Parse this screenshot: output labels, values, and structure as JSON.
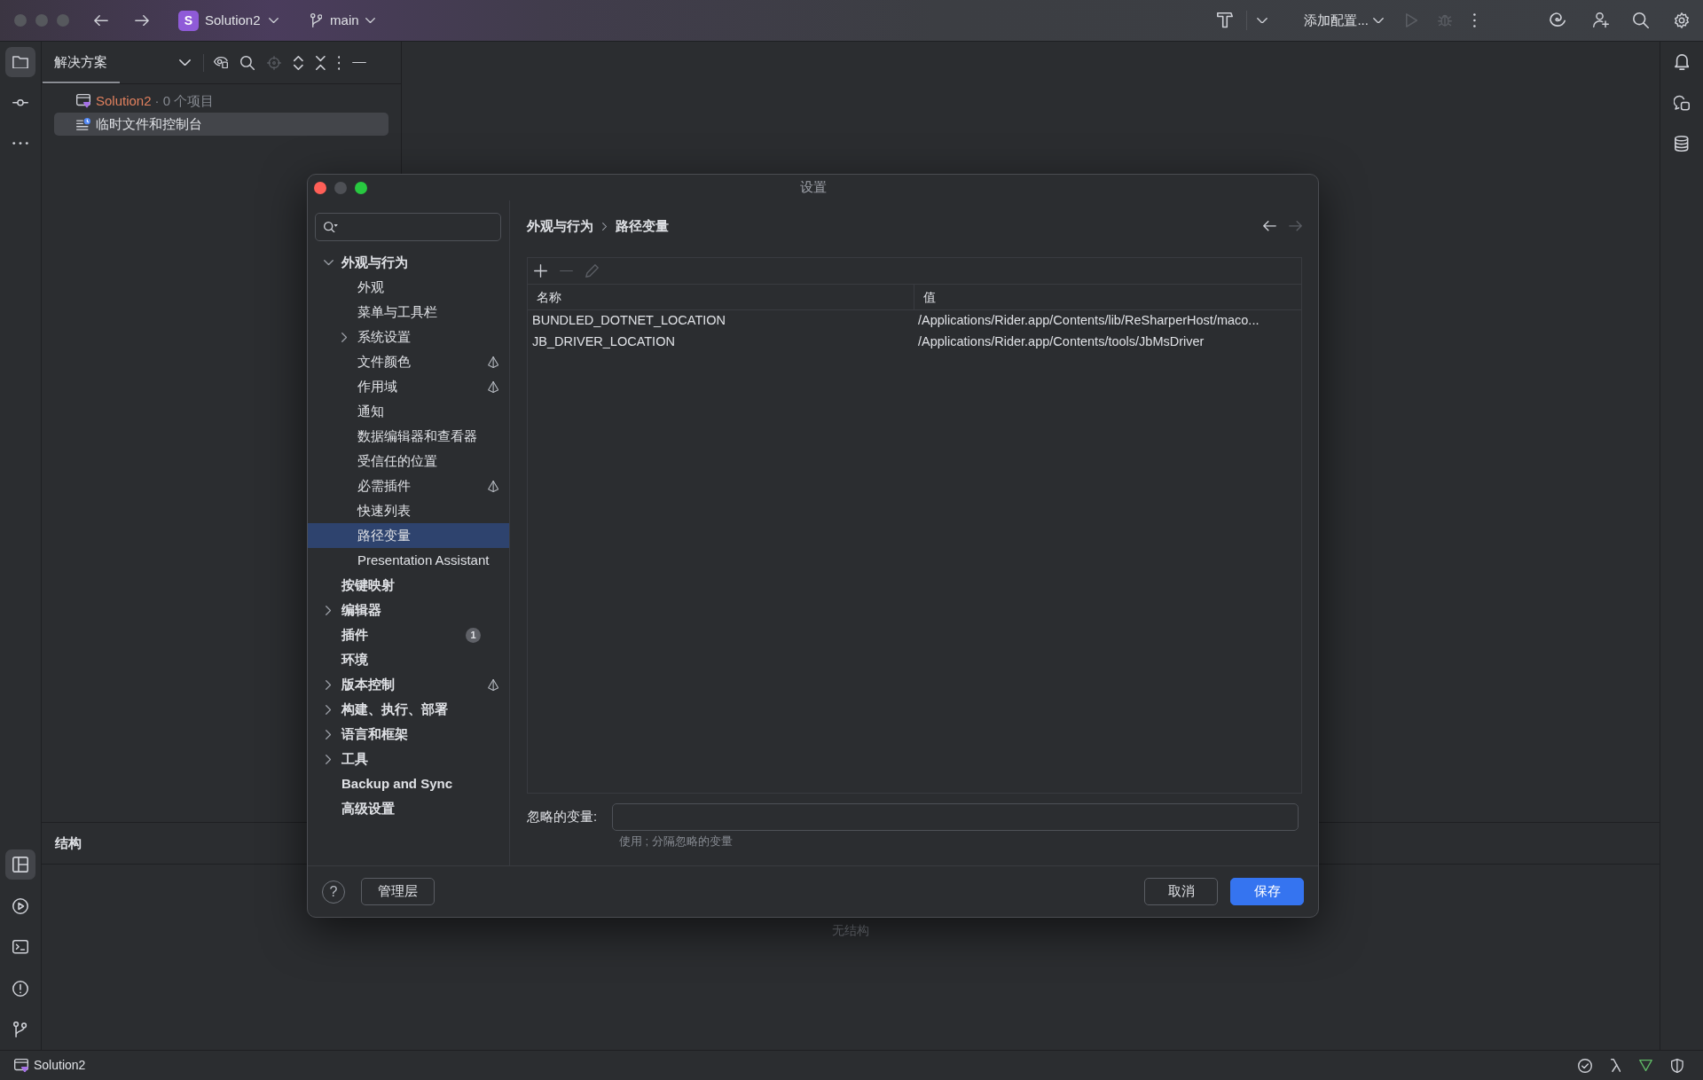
{
  "title_bar": {
    "project_badge": "S",
    "project": "Solution2",
    "branch": "main",
    "run_config": "添加配置...",
    "run_actions": [
      {
        "kind": "run",
        "disabled": true
      },
      {
        "kind": "debug",
        "disabled": true
      }
    ]
  },
  "left_stripe": {
    "top": [
      {
        "kind": "project",
        "selected": true
      },
      {
        "kind": "commit",
        "selected": false
      },
      {
        "kind": "more",
        "selected": false
      }
    ],
    "bottom": [
      {
        "kind": "structure",
        "selected": true
      },
      {
        "kind": "run",
        "selected": false
      },
      {
        "kind": "terminal",
        "selected": false
      },
      {
        "kind": "problems",
        "selected": false
      },
      {
        "kind": "git",
        "selected": false
      }
    ]
  },
  "right_stripe": [
    {
      "kind": "notifications",
      "selected": false
    },
    {
      "kind": "ai_chat",
      "selected": false
    },
    {
      "kind": "database",
      "selected": false
    }
  ],
  "project_panel": {
    "title": "解决方案",
    "tree": [
      {
        "kind": "solution",
        "name": "Solution2",
        "detail": "· 0 个项目",
        "selected": false
      },
      {
        "kind": "scratches",
        "name": "临时文件和控制台",
        "selected": true
      }
    ]
  },
  "structure_panel": {
    "title": "结构",
    "empty_text": "无结构"
  },
  "dialog": {
    "title": "设置",
    "nav": [
      {
        "label": "外观与行为",
        "expanded": true,
        "selected": false,
        "project_level": false,
        "children": [
          {
            "label": "外观",
            "selected": false,
            "project_level": false
          },
          {
            "label": "菜单与工具栏",
            "selected": false,
            "project_level": false
          },
          {
            "label": "系统设置",
            "expanded": false,
            "selected": false,
            "project_level": false
          },
          {
            "label": "文件颜色",
            "selected": false,
            "project_level": true
          },
          {
            "label": "作用域",
            "selected": false,
            "project_level": true
          },
          {
            "label": "通知",
            "selected": false,
            "project_level": false
          },
          {
            "label": "数据编辑器和查看器",
            "selected": false,
            "project_level": false
          },
          {
            "label": "受信任的位置",
            "selected": false,
            "project_level": false
          },
          {
            "label": "必需插件",
            "selected": false,
            "project_level": true
          },
          {
            "label": "快速列表",
            "selected": false,
            "project_level": false
          },
          {
            "label": "路径变量",
            "selected": true,
            "project_level": false
          },
          {
            "label": "Presentation Assistant",
            "selected": false,
            "project_level": false
          }
        ]
      },
      {
        "label": "按键映射",
        "selected": false,
        "project_level": false
      },
      {
        "label": "编辑器",
        "expanded": false,
        "selected": false,
        "project_level": false
      },
      {
        "label": "插件",
        "badge": "1",
        "selected": false,
        "project_level": false
      },
      {
        "label": "环境",
        "selected": false,
        "project_level": false
      },
      {
        "label": "版本控制",
        "expanded": false,
        "selected": false,
        "project_level": true
      },
      {
        "label": "构建、执行、部署",
        "expanded": false,
        "selected": false,
        "project_level": false
      },
      {
        "label": "语言和框架",
        "expanded": false,
        "selected": false,
        "project_level": false
      },
      {
        "label": "工具",
        "expanded": false,
        "selected": false,
        "project_level": false
      },
      {
        "label": "Backup and Sync",
        "selected": false,
        "project_level": false
      },
      {
        "label": "高级设置",
        "selected": false,
        "project_level": false
      }
    ],
    "breadcrumb": [
      "外观与行为",
      "路径变量"
    ],
    "history": [
      {
        "kind": "back",
        "disabled": false
      },
      {
        "kind": "forward",
        "disabled": true
      }
    ],
    "table": {
      "toolbar": [
        {
          "kind": "add",
          "disabled": false
        },
        {
          "kind": "remove",
          "disabled": true
        },
        {
          "kind": "edit",
          "disabled": true
        }
      ],
      "columns": [
        "名称",
        "值"
      ],
      "rows": [
        [
          "BUNDLED_DOTNET_LOCATION",
          "/Applications/Rider.app/Contents/lib/ReSharperHost/maco..."
        ],
        [
          "JB_DRIVER_LOCATION",
          "/Applications/Rider.app/Contents/tools/JbMsDriver"
        ]
      ]
    },
    "ignored_variables": {
      "label": "忽略的变量:",
      "hint": "使用 ; 分隔忽略的变量"
    },
    "footer": {
      "help": "?",
      "manage": "管理层",
      "buttons": [
        {
          "label": "取消",
          "kind": "cancel"
        },
        {
          "label": "保存",
          "kind": "save"
        }
      ]
    }
  },
  "status_bar": {
    "project": "Solution2"
  }
}
